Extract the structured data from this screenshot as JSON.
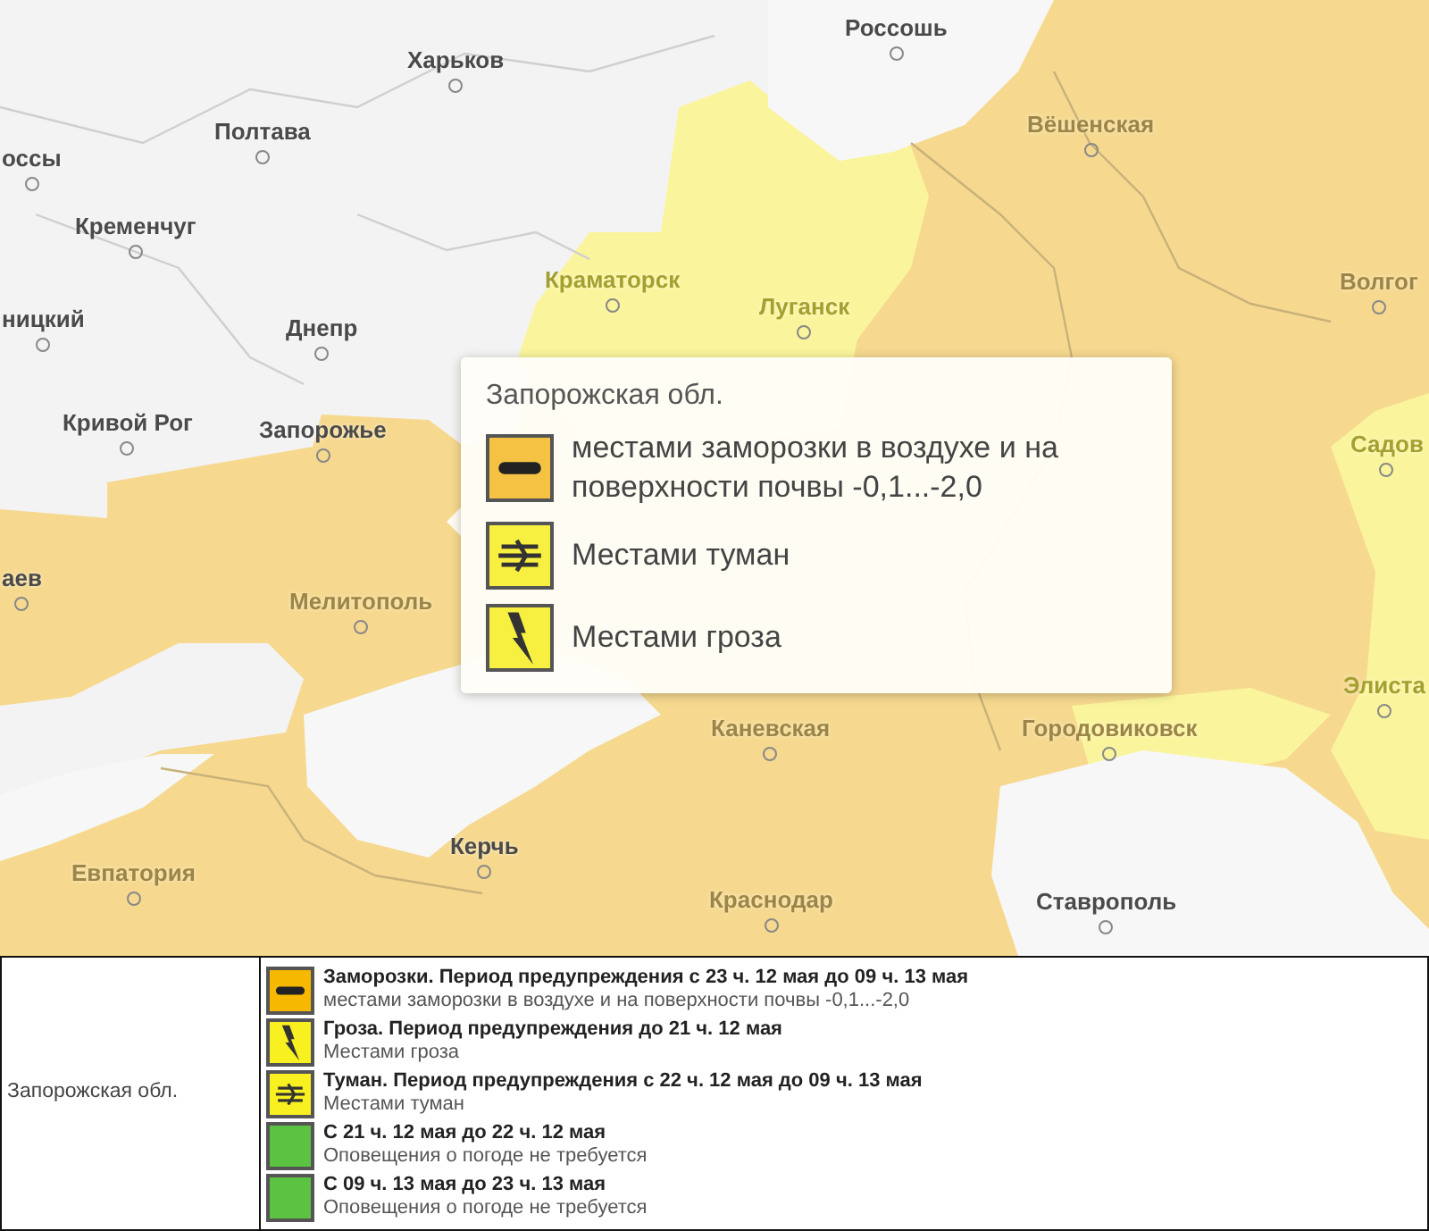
{
  "map": {
    "cities": [
      {
        "name": "Россошь"
      },
      {
        "name": "Харьков"
      },
      {
        "name": "Полтава"
      },
      {
        "name": "оссы"
      },
      {
        "name": "Вёшенская"
      },
      {
        "name": "Кременчуг"
      },
      {
        "name": "Волгог"
      },
      {
        "name": "Краматорск"
      },
      {
        "name": "Луганск"
      },
      {
        "name": "ницкий"
      },
      {
        "name": "Днепр"
      },
      {
        "name": "Кривой Рог"
      },
      {
        "name": "Запорожье"
      },
      {
        "name": "Садов"
      },
      {
        "name": "аев"
      },
      {
        "name": "Мелитополь"
      },
      {
        "name": "Элиста"
      },
      {
        "name": "Каневская"
      },
      {
        "name": "Городовиковск"
      },
      {
        "name": "Керчь"
      },
      {
        "name": "Евпатория"
      },
      {
        "name": "Краснодар"
      },
      {
        "name": "Ставрополь"
      }
    ]
  },
  "tooltip": {
    "title": "Запорожская обл.",
    "items": [
      {
        "kind": "frost",
        "color": "#f6c244",
        "text": "местами заморозки в воздухе и на поверхности почвы -0,1...-2,0"
      },
      {
        "kind": "fog",
        "color": "#f8f040",
        "text": "Местами туман"
      },
      {
        "kind": "thunderstorm",
        "color": "#f8f040",
        "text": "Местами гроза"
      }
    ]
  },
  "table": {
    "region": "Запорожская обл.",
    "warnings": [
      {
        "kind": "frost",
        "color": "#f6b800",
        "title": "Заморозки. Период предупреждения с 23 ч. 12 мая до 09 ч. 13 мая",
        "text": "местами заморозки в воздухе и на поверхности почвы -0,1...-2,0"
      },
      {
        "kind": "thunderstorm",
        "color": "#f8f020",
        "title": "Гроза. Период предупреждения до 21 ч. 12 мая",
        "text": "Местами гроза"
      },
      {
        "kind": "fog",
        "color": "#f8f020",
        "title": "Туман. Период предупреждения с 22 ч. 12 мая до 09 ч. 13 мая",
        "text": "Местами туман"
      },
      {
        "kind": "none",
        "color": "#5cc342",
        "title": "С 21 ч. 12 мая до 22 ч. 12 мая",
        "text": "Оповещения о погоде не требуется"
      },
      {
        "kind": "none",
        "color": "#5cc342",
        "title": "С 09 ч. 13 мая до 23 ч. 13 мая",
        "text": "Оповещения о погоде не требуется"
      }
    ]
  }
}
